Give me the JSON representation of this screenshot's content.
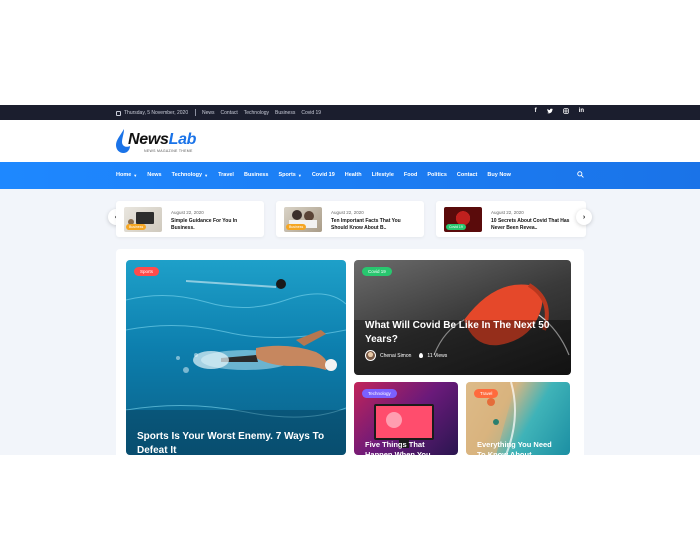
{
  "topbar": {
    "date": "Thursday, 5 November, 2020",
    "links": [
      "News",
      "Contact",
      "Technology",
      "Business",
      "Covid 19"
    ],
    "social": [
      "facebook-icon",
      "twitter-icon",
      "instagram-icon",
      "linkedin-icon"
    ]
  },
  "logo": {
    "name_part1": "News",
    "name_part2": "Lab",
    "tagline": "NEWS MAGAZINE THEME"
  },
  "nav": {
    "items": [
      {
        "label": "Home",
        "dropdown": true
      },
      {
        "label": "News",
        "dropdown": false
      },
      {
        "label": "Technology",
        "dropdown": true
      },
      {
        "label": "Travel",
        "dropdown": false
      },
      {
        "label": "Business",
        "dropdown": false
      },
      {
        "label": "Sports",
        "dropdown": true
      },
      {
        "label": "Covid 19",
        "dropdown": false
      },
      {
        "label": "Health",
        "dropdown": false
      },
      {
        "label": "Lifestyle",
        "dropdown": false
      },
      {
        "label": "Food",
        "dropdown": false
      },
      {
        "label": "Politics",
        "dropdown": false
      },
      {
        "label": "Contact",
        "dropdown": false
      },
      {
        "label": "Buy Now",
        "dropdown": false
      }
    ],
    "search_icon": "search-icon"
  },
  "ticker": [
    {
      "badge": "Business",
      "badge_color": "#f5a623",
      "date": "August 22, 2020",
      "title": "Simple Guidance For You In Business."
    },
    {
      "badge": "Business",
      "badge_color": "#f5a623",
      "date": "August 22, 2020",
      "title": "Ten Important Facts That You Should Know About B.."
    },
    {
      "badge": "Covid 19",
      "badge_color": "#28c76f",
      "date": "August 22, 2020",
      "title": "10 Secrets About Covid That Has Never Been Revea.."
    }
  ],
  "features": {
    "big": {
      "category": "Sports",
      "category_color": "#ff4b4b",
      "title": "Sports Is Your Worst Enemy. 7 Ways To Defeat It"
    },
    "top_right": {
      "category": "Covid 19",
      "category_color": "#28c76f",
      "title": "What Will Covid Be Like In The Next 50 Years?",
      "author": "Chenai Simon",
      "views": "11 Views"
    },
    "small_left": {
      "category": "Technology",
      "category_color": "#7b61ff",
      "title": "Five Things That Happen When You"
    },
    "small_right": {
      "category": "Travel",
      "category_color": "#ff6b3d",
      "title": "Everything You Need To Know About"
    }
  },
  "colors": {
    "primary": "#1a73e8",
    "topbar": "#1b1e2e",
    "content_bg": "#f2f5fa"
  }
}
